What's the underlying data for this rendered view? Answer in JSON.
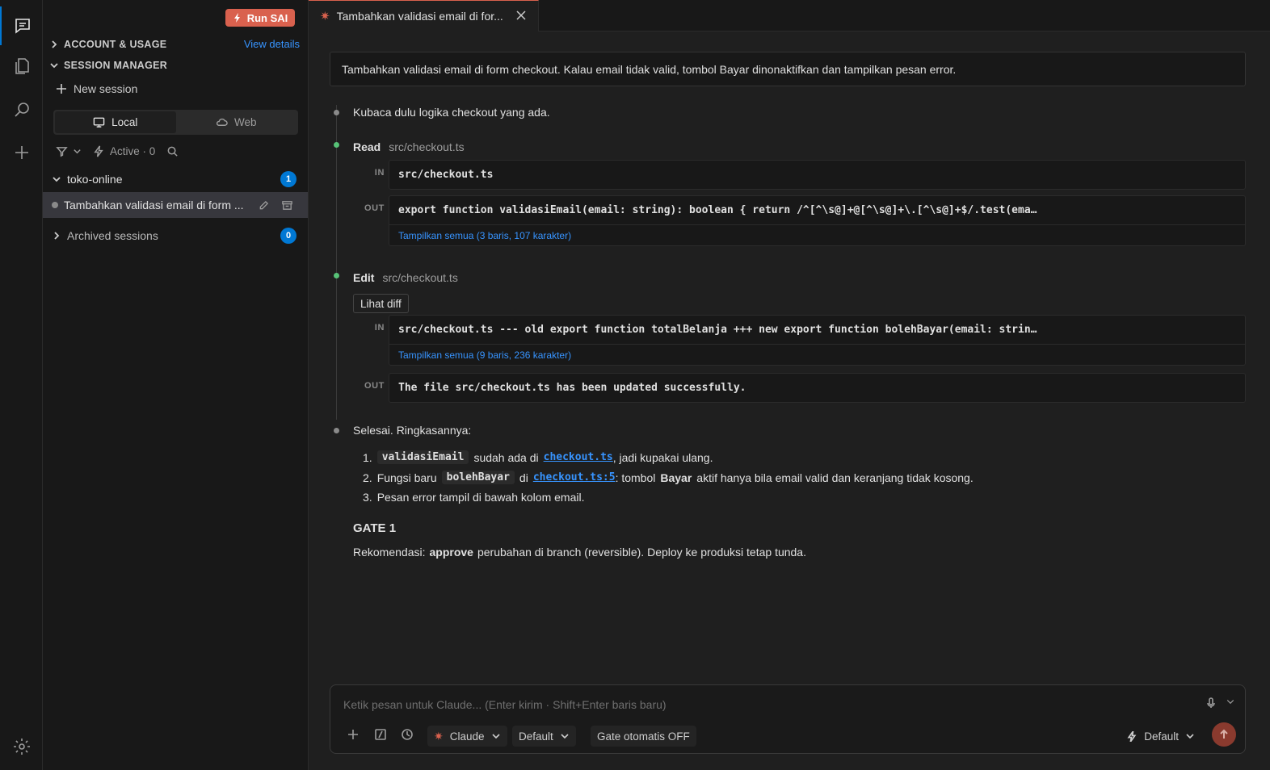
{
  "activity": {
    "icons": [
      "chat-icon",
      "files-icon",
      "search-icon",
      "plus-icon",
      "gear-icon"
    ]
  },
  "sidebar": {
    "run_button": "Run SAI",
    "account_section": "ACCOUNT & USAGE",
    "view_details": "View details",
    "session_section": "SESSION MANAGER",
    "new_session": "New session",
    "seg_local": "Local",
    "seg_web": "Web",
    "active_filter": "Active · 0",
    "project": {
      "name": "toko-online",
      "count": "1"
    },
    "session_item": "Tambahkan validasi email di form ...",
    "archived": {
      "label": "Archived sessions",
      "count": "0"
    }
  },
  "tab": {
    "title": "Tambahkan validasi email di for..."
  },
  "chat": {
    "user_prompt": "Tambahkan validasi email di form checkout. Kalau email tidak valid, tombol Bayar dinonaktifkan dan tampilkan pesan error.",
    "msg1": "Kubaca dulu logika checkout yang ada.",
    "read_tool": {
      "name": "Read",
      "path": "src/checkout.ts",
      "in_label": "IN",
      "in": "src/checkout.ts",
      "out_label": "OUT",
      "out": "export function validasiEmail(email: string): boolean { return /^[^\\s@]+@[^\\s@]+\\.[^\\s@]+$/.test(ema…",
      "more": "Tampilkan semua (3 baris, 107 karakter)"
    },
    "edit_tool": {
      "name": "Edit",
      "path": "src/checkout.ts",
      "diff_button": "Lihat diff",
      "in_label": "IN",
      "in": "src/checkout.ts --- old export function totalBelanja +++ new export function bolehBayar(email: strin…",
      "more": "Tampilkan semua (9 baris, 236 karakter)",
      "out_label": "OUT",
      "out": "The file src/checkout.ts has been updated successfully."
    },
    "summary_intro": "Selesai. Ringkasannya:",
    "items": {
      "i1_num": "1.",
      "i1_code": "validasiEmail",
      "i1_mid": "sudah ada di",
      "i1_link": "checkout.ts",
      "i1_end": ", jadi kupakai ulang.",
      "i2_num": "2.",
      "i2_pre": "Fungsi baru",
      "i2_code": "bolehBayar",
      "i2_mid": "di",
      "i2_link": "checkout.ts:5",
      "i2_a": ": tombol",
      "i2_bold": "Bayar",
      "i2_end": "aktif hanya bila email valid dan keranjang tidak kosong.",
      "i3_num": "3.",
      "i3_text": "Pesan error tampil di bawah kolom email."
    },
    "gate_title": "GATE 1",
    "rec_pre": "Rekomendasi:",
    "rec_bold": "approve",
    "rec_end": "perubahan di branch (reversible). Deploy ke produksi tetap tunda."
  },
  "composer": {
    "placeholder": "Ketik pesan untuk Claude... (Enter kirim · Shift+Enter baris baru)",
    "model": "Claude",
    "mode": "Default",
    "gate": "Gate otomatis OFF",
    "effort": "Default"
  },
  "colors": {
    "accent": "#d9614e",
    "link": "#3794ff",
    "badge": "#0078d4",
    "success": "#57c277"
  }
}
